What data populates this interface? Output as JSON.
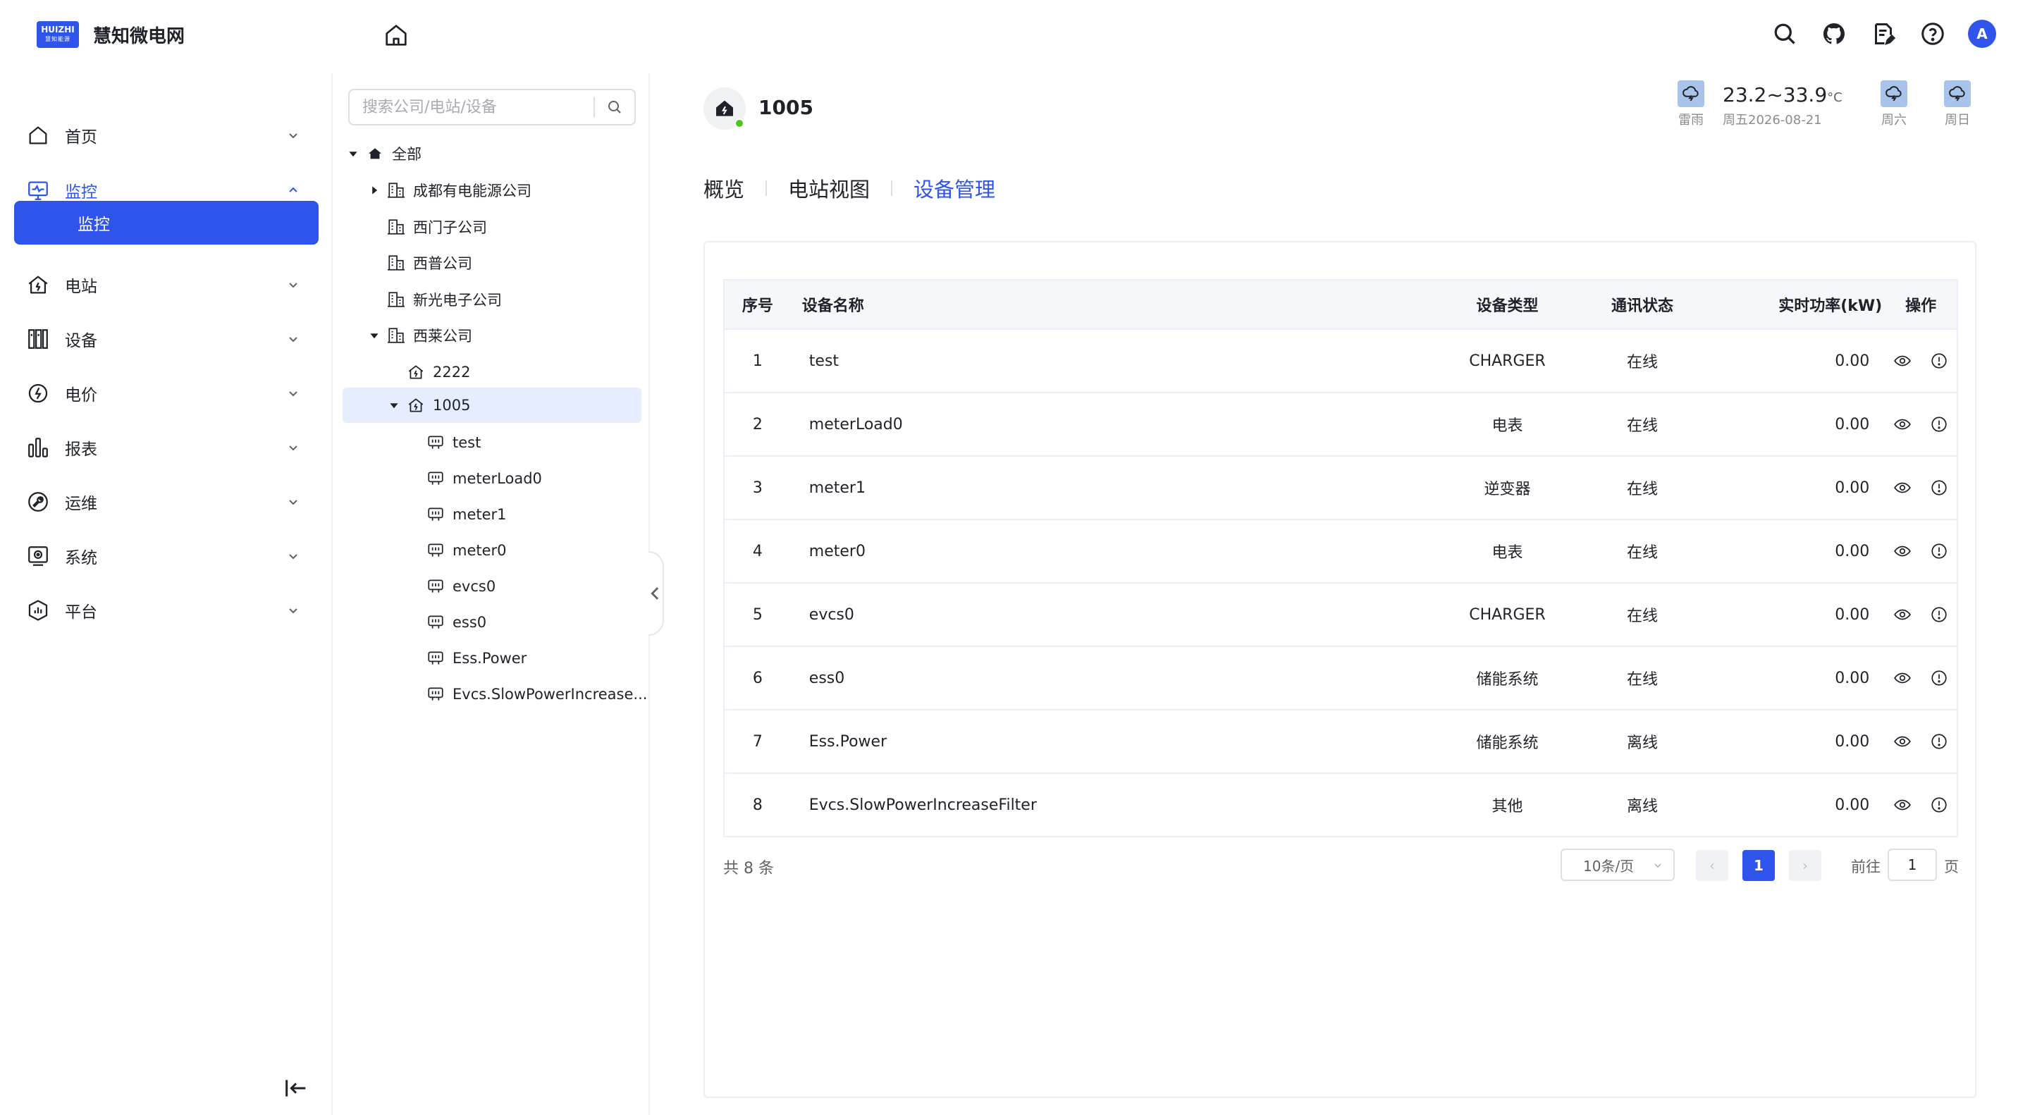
{
  "brand": {
    "badge_top": "HUIZHI",
    "badge_sub": "慧知能源",
    "name": "慧知微电网"
  },
  "sidebar": {
    "items": [
      {
        "label": "首页"
      },
      {
        "label": "监控"
      },
      {
        "label": "电站"
      },
      {
        "label": "设备"
      },
      {
        "label": "电价"
      },
      {
        "label": "报表"
      },
      {
        "label": "运维"
      },
      {
        "label": "系统"
      },
      {
        "label": "平台"
      }
    ],
    "sub_active": "监控"
  },
  "tree": {
    "search_placeholder": "搜索公司/电站/设备",
    "nodes": [
      {
        "label": "全部"
      },
      {
        "label": "成都有电能源公司"
      },
      {
        "label": "西门子公司"
      },
      {
        "label": "西普公司"
      },
      {
        "label": "新光电子公司"
      },
      {
        "label": "西莱公司"
      },
      {
        "label": "2222"
      },
      {
        "label": "1005"
      },
      {
        "label": "test"
      },
      {
        "label": "meterLoad0"
      },
      {
        "label": "meter1"
      },
      {
        "label": "meter0"
      },
      {
        "label": "evcs0"
      },
      {
        "label": "ess0"
      },
      {
        "label": "Ess.Power"
      },
      {
        "label": "Evcs.SlowPowerIncrease..."
      }
    ]
  },
  "station": {
    "name": "1005"
  },
  "weather": {
    "today_label": "雷雨",
    "temp": "23.2~33.9",
    "unit": "°C",
    "date": "周五2026-08-21",
    "day2": "周六",
    "day3": "周日"
  },
  "tabs": [
    "概览",
    "电站视图",
    "设备管理"
  ],
  "table": {
    "headers": [
      "序号",
      "设备名称",
      "设备类型",
      "通讯状态",
      "实时功率(kW)",
      "操作"
    ],
    "rows": [
      {
        "idx": "1",
        "name": "test",
        "type": "CHARGER",
        "comm": "在线",
        "power": "0.00"
      },
      {
        "idx": "2",
        "name": "meterLoad0",
        "type": "电表",
        "comm": "在线",
        "power": "0.00"
      },
      {
        "idx": "3",
        "name": "meter1",
        "type": "逆变器",
        "comm": "在线",
        "power": "0.00"
      },
      {
        "idx": "4",
        "name": "meter0",
        "type": "电表",
        "comm": "在线",
        "power": "0.00"
      },
      {
        "idx": "5",
        "name": "evcs0",
        "type": "CHARGER",
        "comm": "在线",
        "power": "0.00"
      },
      {
        "idx": "6",
        "name": "ess0",
        "type": "储能系统",
        "comm": "在线",
        "power": "0.00"
      },
      {
        "idx": "7",
        "name": "Ess.Power",
        "type": "储能系统",
        "comm": "离线",
        "power": "0.00"
      },
      {
        "idx": "8",
        "name": "Evcs.SlowPowerIncreaseFilter",
        "type": "其他",
        "comm": "离线",
        "power": "0.00"
      }
    ]
  },
  "pager": {
    "total": "共 8 条",
    "page_size": "10条/页",
    "prev": "‹",
    "current": "1",
    "next": "›",
    "goto_prefix": "前往",
    "goto_value": "1",
    "goto_suffix": "页"
  },
  "user": {
    "avatar": "A"
  },
  "colors": {
    "accent": "#2f54eb",
    "online_dot": "#52c41a",
    "selected_bg": "#e6edfd"
  }
}
